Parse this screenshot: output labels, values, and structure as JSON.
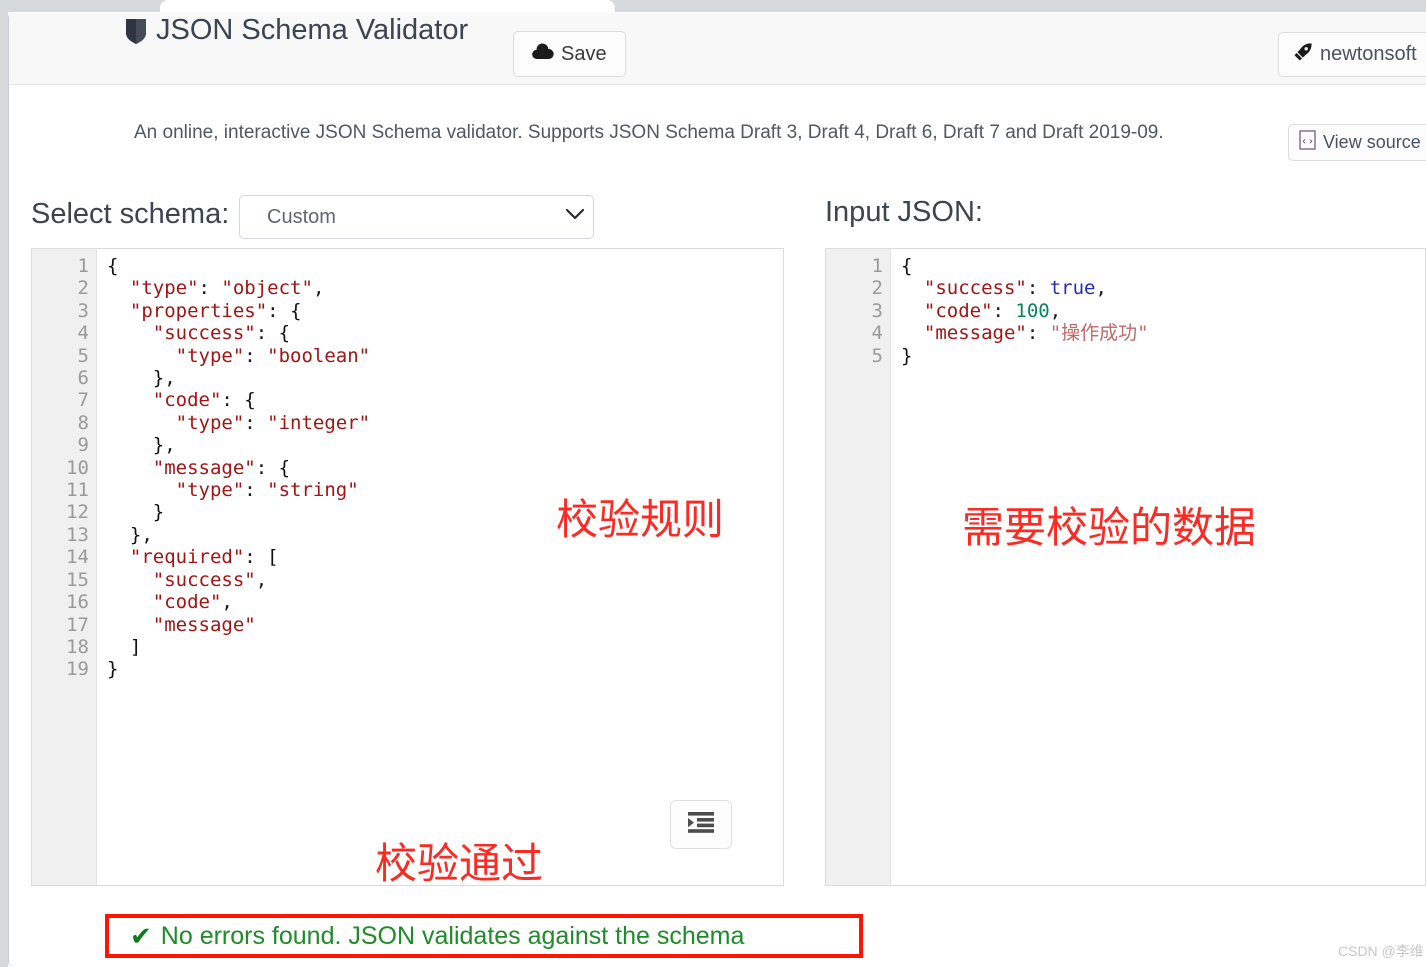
{
  "app": {
    "title": "JSON Schema Validator",
    "description": "An online, interactive JSON Schema validator. Supports JSON Schema Draft 3, Draft 4, Draft 6, Draft 7 and Draft 2019-09."
  },
  "navbar": {
    "brand_icon": "shield-icon",
    "save_label": "Save",
    "save_icon": "cloud-upload-icon",
    "newtonsoft_label": "newtonsoft",
    "newtonsoft_icon": "rocket-icon"
  },
  "toolbar": {
    "view_source_label": "View source",
    "view_source_icon": "code-file-icon"
  },
  "schema_panel": {
    "label": "Select schema:",
    "select_value": "Custom",
    "select_options": [
      "Custom"
    ],
    "format_icon": "indent-format-icon",
    "code_lines": [
      "{",
      "  \"type\": \"object\",",
      "  \"properties\": {",
      "    \"success\": {",
      "      \"type\": \"boolean\"",
      "    },",
      "    \"code\": {",
      "      \"type\": \"integer\"",
      "    },",
      "    \"message\": {",
      "      \"type\": \"string\"",
      "    }",
      "  },",
      "  \"required\": [",
      "    \"success\",",
      "    \"code\",",
      "    \"message\"",
      "  ]",
      "}"
    ],
    "line_numbers": "1\n2\n3\n4\n5\n6\n7\n8\n9\n10\n11\n12\n13\n14\n15\n16\n17\n18\n19"
  },
  "input_panel": {
    "label": "Input JSON:",
    "code_lines": [
      "{",
      "  \"success\": true,",
      "  \"code\": 100,",
      "  \"message\": \"操作成功\"",
      "}"
    ],
    "line_numbers": "1\n2\n3\n4\n5"
  },
  "annotations": {
    "rules": "校验规则",
    "data": "需要校验的数据",
    "passed": "校验通过",
    "color": "#fc2a22"
  },
  "status": {
    "icon": "check-mark-icon",
    "message": "No errors found. JSON validates against the schema",
    "text_color": "#1f8b2a",
    "border_color": "#fd1500"
  },
  "watermark": {
    "text": "CSDN @李维"
  }
}
